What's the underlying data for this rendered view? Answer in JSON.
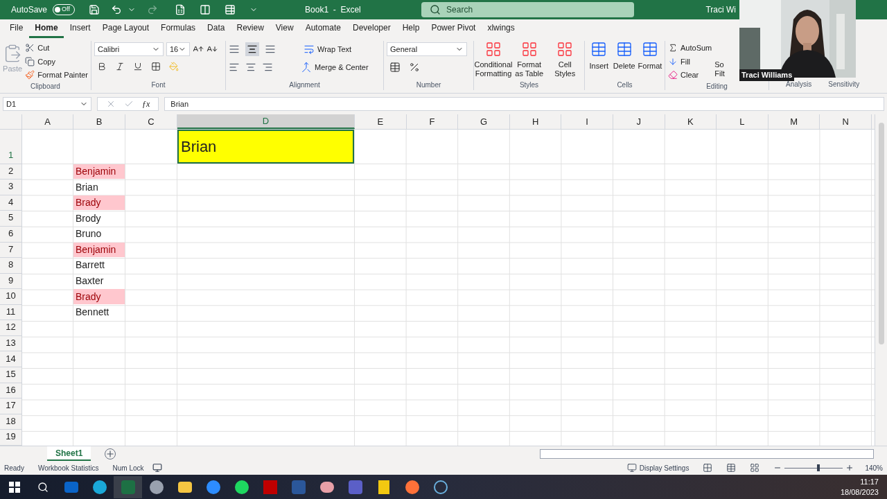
{
  "title_bar": {
    "autosave_label": "AutoSave",
    "autosave": {
      "label": "Off",
      "on": false
    },
    "title": "Book1  -  Excel",
    "search_placeholder": "Search",
    "user": "Traci Wi"
  },
  "menu_tabs": [
    {
      "label": "File",
      "selected": false
    },
    {
      "label": "Home",
      "selected": true
    },
    {
      "label": "Insert",
      "selected": false
    },
    {
      "label": "Page Layout",
      "selected": false
    },
    {
      "label": "Formulas",
      "selected": false
    },
    {
      "label": "Data",
      "selected": false
    },
    {
      "label": "Review",
      "selected": false
    },
    {
      "label": "View",
      "selected": false
    },
    {
      "label": "Automate",
      "selected": false
    },
    {
      "label": "Developer",
      "selected": false
    },
    {
      "label": "Help",
      "selected": false
    },
    {
      "label": "Power Pivot",
      "selected": false
    },
    {
      "label": "xlwings",
      "selected": false
    }
  ],
  "ribbon": {
    "clipboard": {
      "paste": "Paste",
      "cut": "Cut",
      "copy": "Copy",
      "format_painter": "Format Painter",
      "label": "Clipboard"
    },
    "font": {
      "font_name": "Calibri",
      "font_size": "16",
      "label": "Font"
    },
    "alignment": {
      "wrap_text": "Wrap Text",
      "merge": "Merge & Center",
      "label": "Alignment"
    },
    "number": {
      "format": "General",
      "label": "Number"
    },
    "styles": {
      "buttons": [
        "Conditional Formatting",
        "Format as Table",
        "Cell Styles"
      ],
      "label": "Styles"
    },
    "cells": {
      "buttons": [
        "Insert",
        "Delete",
        "Format"
      ],
      "label": "Cells"
    },
    "editing": {
      "autosum": "AutoSum",
      "fill": "Fill",
      "clear": "Clear",
      "sort_partial": "So",
      "filter_partial": "Filt",
      "label": "Editing"
    },
    "extra_labels": [
      "Analysis",
      "Sensitivity"
    ]
  },
  "formula_bar": {
    "name_box": "D1",
    "function_label": "ƒx",
    "value": "Brian"
  },
  "video": {
    "name": "Traci Williams"
  },
  "columns": [
    "A",
    "B",
    "C",
    "D",
    "E",
    "F",
    "G",
    "H",
    "I",
    "J",
    "K",
    "L",
    "M",
    "N"
  ],
  "active_cell": {
    "text": "Brian"
  },
  "rows": [
    {
      "label": "1"
    },
    {
      "label": "2",
      "b": {
        "text": "Benjamin",
        "highlighted": true
      }
    },
    {
      "label": "3",
      "b": {
        "text": "Brian",
        "highlighted": false
      }
    },
    {
      "label": "4",
      "b": {
        "text": "Brady",
        "highlighted": true
      }
    },
    {
      "label": "5",
      "b": {
        "text": "Brody",
        "highlighted": false
      }
    },
    {
      "label": "6",
      "b": {
        "text": "Bruno",
        "highlighted": false
      }
    },
    {
      "label": "7",
      "b": {
        "text": "Benjamin",
        "highlighted": true
      }
    },
    {
      "label": "8",
      "b": {
        "text": "Barrett",
        "highlighted": false
      }
    },
    {
      "label": "9",
      "b": {
        "text": "Baxter",
        "highlighted": false
      }
    },
    {
      "label": "10",
      "b": {
        "text": "Brady",
        "highlighted": true
      }
    },
    {
      "label": "11",
      "b": {
        "text": "Bennett",
        "highlighted": false
      }
    },
    {
      "label": "12"
    },
    {
      "label": "13"
    },
    {
      "label": "14"
    },
    {
      "label": "15"
    },
    {
      "label": "16"
    },
    {
      "label": "17"
    },
    {
      "label": "18"
    },
    {
      "label": "19"
    }
  ],
  "sheet_tabs": [
    {
      "label": "Sheet1",
      "selected": true
    }
  ],
  "status_bar": {
    "items": [
      "Ready",
      "Workbook Statistics",
      "Num Lock"
    ],
    "display_settings": "Display Settings",
    "zoom": {
      "level": 0.55,
      "reading": "140%"
    }
  },
  "taskbar": {
    "time": "11:17",
    "date": "18/08/2023"
  }
}
